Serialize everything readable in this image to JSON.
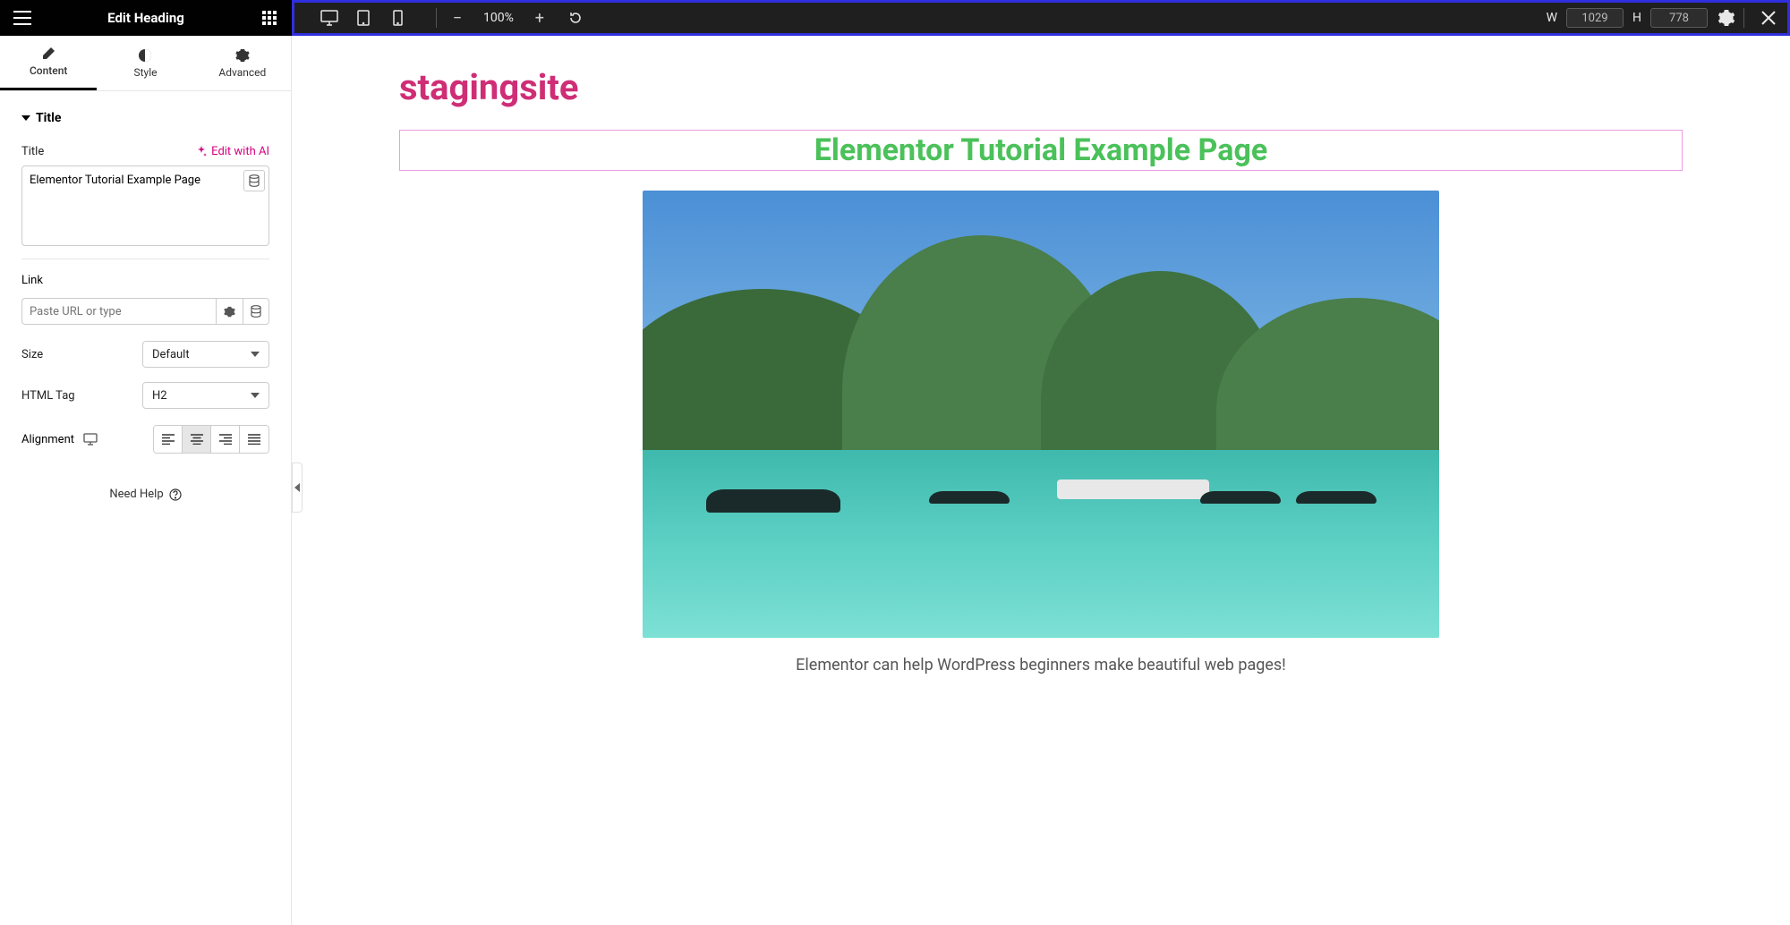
{
  "topbar": {
    "panel_title": "Edit Heading",
    "zoom": "100%",
    "width_label": "W",
    "width_value": "1029",
    "height_label": "H",
    "height_value": "778"
  },
  "tabs": {
    "content": "Content",
    "style": "Style",
    "advanced": "Advanced"
  },
  "section": {
    "title": "Title"
  },
  "fields": {
    "title_label": "Title",
    "ai_link": "Edit with AI",
    "title_value": "Elementor Tutorial Example Page",
    "link_label": "Link",
    "link_placeholder": "Paste URL or type",
    "size_label": "Size",
    "size_value": "Default",
    "tag_label": "HTML Tag",
    "tag_value": "H2",
    "alignment_label": "Alignment"
  },
  "help": "Need Help",
  "canvas": {
    "site_title": "stagingsite",
    "heading": "Elementor Tutorial Example Page",
    "caption": "Elementor can help WordPress beginners make beautiful web pages!"
  }
}
